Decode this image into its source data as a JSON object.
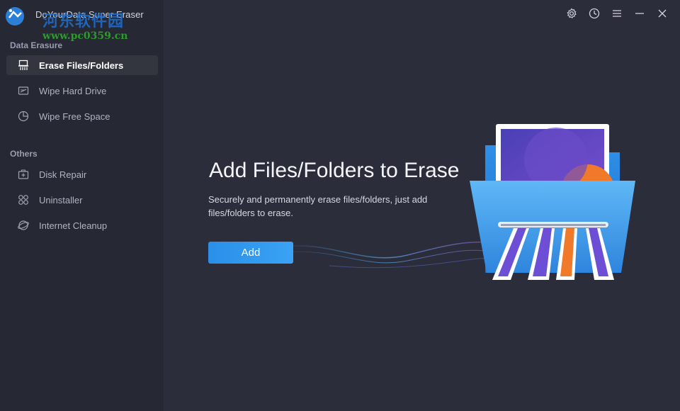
{
  "window": {
    "title": "DoYourData Super Eraser",
    "watermark_text": "河东软件园",
    "watermark_url": "www.pc0359.cn"
  },
  "sidebar": {
    "sections": [
      {
        "title": "Data Erasure",
        "items": [
          {
            "label": "Erase Files/Folders",
            "icon": "shredder-icon",
            "active": true
          },
          {
            "label": "Wipe Hard Drive",
            "icon": "hard-drive-icon",
            "active": false
          },
          {
            "label": "Wipe Free Space",
            "icon": "pie-chart-icon",
            "active": false
          }
        ]
      },
      {
        "title": "Others",
        "items": [
          {
            "label": "Disk Repair",
            "icon": "first-aid-kit-icon",
            "active": false
          },
          {
            "label": "Uninstaller",
            "icon": "apps-grid-icon",
            "active": false
          },
          {
            "label": "Internet Cleanup",
            "icon": "globe-broom-icon",
            "active": false
          }
        ]
      }
    ]
  },
  "toolbar": {
    "icons": [
      "gear-icon",
      "history-clock-icon",
      "menu-icon",
      "minimize-icon",
      "close-icon"
    ]
  },
  "main": {
    "title": "Add Files/Folders to Erase",
    "description": "Securely and permanently erase files/folders, just add files/folders to erase.",
    "add_button_label": "Add"
  },
  "colors": {
    "background": "#2b2d3a",
    "sidebar": "#262833",
    "active_item": "#33363f",
    "accent": "#2a8fe8"
  }
}
